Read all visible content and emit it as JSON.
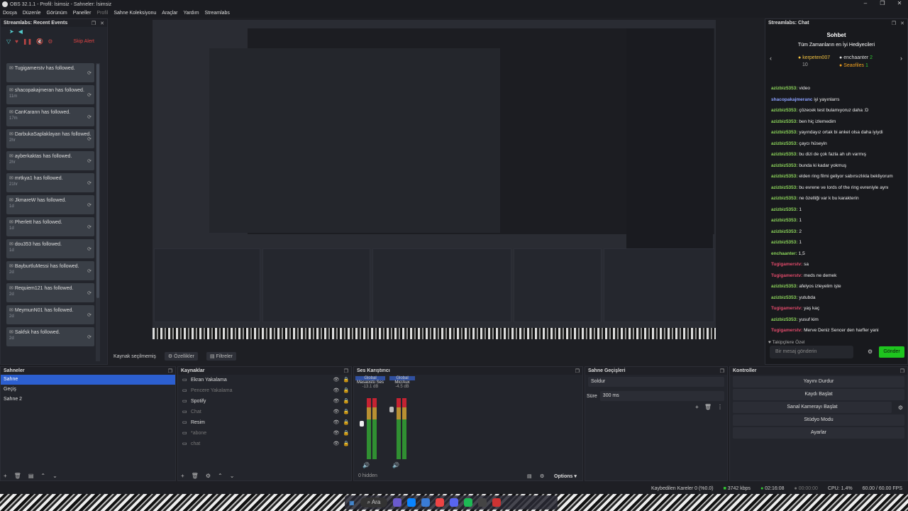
{
  "window": {
    "title": "OBS 32.1.1 - Profil: İsimsiz - Sahneler: İsimsiz"
  },
  "menu": [
    "Dosya",
    "Düzenle",
    "Görünüm",
    "Paneller",
    "Profil",
    "Sahne Koleksiyonu",
    "Araçlar",
    "Yardım",
    "Streamlabs"
  ],
  "events": {
    "title": "Streamlabs: Recent Events",
    "skip_label": "Skip Alert",
    "items": [
      {
        "name": "Tugigamerstv",
        "text": "has followed.",
        "time": ""
      },
      {
        "name": "shacopakajmeran",
        "text": "has followed.",
        "time": "11m"
      },
      {
        "name": "CanKarann",
        "text": "has followed.",
        "time": "17m"
      },
      {
        "name": "DarbukaSaplaklayan",
        "text": "has followed.",
        "time": "2hr"
      },
      {
        "name": "ayberkaktas",
        "text": "has followed.",
        "time": "2hr"
      },
      {
        "name": "mrtkya1",
        "text": "has followed.",
        "time": "21hr"
      },
      {
        "name": "JkmareW",
        "text": "has followed.",
        "time": "1d"
      },
      {
        "name": "Pherlett",
        "text": "has followed.",
        "time": "1d"
      },
      {
        "name": "dou353",
        "text": "has followed.",
        "time": "1d"
      },
      {
        "name": "BayburtluMessi",
        "text": "has followed.",
        "time": "2d"
      },
      {
        "name": "Requiem121",
        "text": "has followed.",
        "time": "2d"
      },
      {
        "name": "MeymunN01",
        "text": "has followed.",
        "time": "2d"
      },
      {
        "name": "Sakfsk",
        "text": "has followed.",
        "time": "2d"
      }
    ]
  },
  "preview": {
    "source_status": "Kaynak seçilmemiş",
    "properties_label": "Özellikler",
    "filters_label": "Filtreler"
  },
  "chat": {
    "title": "Streamlabs: Chat",
    "header": "Sohbet",
    "subheader": "Tüm Zamanların en İyi Hediyecileri",
    "leaders": [
      {
        "name": "kerpeten007",
        "score": "10"
      },
      {
        "name": "enchaanter",
        "score": "2"
      },
      {
        "name": "Seaofiles",
        "score": "1"
      }
    ],
    "messages": [
      {
        "user": "azizbiz5353:",
        "text": "video",
        "style": "u1"
      },
      {
        "user": "shacopakajmeranc",
        "text": "iyi yayınlarrs",
        "style": "u2"
      },
      {
        "user": "azizbiz5353:",
        "text": "çözecek test bulamıyoruz daha :D",
        "style": "u1"
      },
      {
        "user": "azizbiz5353:",
        "text": "ben hiç izlemedim",
        "style": "u1"
      },
      {
        "user": "azizbiz5353:",
        "text": "yayındayız ortak bi anket olsa daha iyiydi",
        "style": "u1"
      },
      {
        "user": "azizbiz5353:",
        "text": "çaycı hüseyin",
        "style": "u1"
      },
      {
        "user": "azizbiz5353:",
        "text": "bu dizi de çok fazla ah uh varmış",
        "style": "u1"
      },
      {
        "user": "azizbiz5353:",
        "text": "bunda ki kadar yokmuş",
        "style": "u1"
      },
      {
        "user": "azizbiz5353:",
        "text": "elden ring filmi geliyor sabırsızlıkla bekliyorum",
        "style": "u1"
      },
      {
        "user": "azizbiz5353:",
        "text": "bu evrene ve lords of the ring evreniyle aynı",
        "style": "u1"
      },
      {
        "user": "azizbiz5353:",
        "text": "ne özelliği var k bu karakterin",
        "style": "u1"
      },
      {
        "user": "azizbiz5353:",
        "text": "1",
        "style": "u1"
      },
      {
        "user": "azizbiz5353:",
        "text": "1",
        "style": "u1"
      },
      {
        "user": "azizbiz5353:",
        "text": "2",
        "style": "u1"
      },
      {
        "user": "azizbiz5353:",
        "text": "1",
        "style": "u1"
      },
      {
        "user": "enchaanter:",
        "text": "1,5",
        "style": "u4"
      },
      {
        "user": "Tugigamerstv:",
        "text": "sa",
        "style": "u3"
      },
      {
        "user": "Tugigamerstv:",
        "text": "meds ne demek",
        "style": "u3"
      },
      {
        "user": "azizbiz5353:",
        "text": "afelyos izleyelim işte",
        "style": "u1"
      },
      {
        "user": "azizbiz5353:",
        "text": "yutubda",
        "style": "u1"
      },
      {
        "user": "Tugigamerstv:",
        "text": "yaş kaç",
        "style": "u3"
      },
      {
        "user": "azizbiz5353:",
        "text": "yusuf kim",
        "style": "u1"
      },
      {
        "user": "Tugigamerstv:",
        "text": "Merve Deniz Sencer den harfler yani",
        "style": "u3"
      }
    ],
    "followers_only": "Takipçilere Özel",
    "input_placeholder": "Bir mesaj gönderin",
    "send_label": "Gönder"
  },
  "scenes": {
    "title": "Sahneler",
    "items": [
      "Sahne",
      "Geçiş",
      "Sahne 2"
    ],
    "selected": 0
  },
  "sources": {
    "title": "Kaynaklar",
    "items": [
      {
        "name": "Ekran Yakalama",
        "dim": false
      },
      {
        "name": "Pencere Yakalama",
        "dim": true
      },
      {
        "name": "Spotify",
        "dim": false
      },
      {
        "name": "Chat",
        "dim": true
      },
      {
        "name": "Resim",
        "dim": false
      },
      {
        "name": "*abone",
        "dim": true
      },
      {
        "name": "chat",
        "dim": true
      }
    ]
  },
  "mixer": {
    "title": "Ses Karıştırıcı",
    "ch1": {
      "label": "Masaüstü Ses",
      "tag": "Global",
      "db": "-13.1 dB"
    },
    "ch2": {
      "label": "Mic/Aux",
      "tag": "Global",
      "db": "-4.5 dB"
    },
    "hidden": "0 hidden",
    "options": "Options"
  },
  "transitions": {
    "title": "Sahne Geçişleri",
    "type": "Soldur",
    "duration_label": "Süre",
    "duration": "300 ms"
  },
  "controls": {
    "title": "Kontroller",
    "buttons": [
      "Yayını Durdur",
      "Kaydı Başlat",
      "Sanal Kamerayı Başlat",
      "Stüdyo Modu",
      "Ayarlar"
    ]
  },
  "status": {
    "dropped": "Kaybedilen Kareler 0 (%0.0)",
    "kbps": "3742 kbps",
    "live_time": "02:16:08",
    "rec_time": "00:00:00",
    "cpu": "CPU: 1.4%",
    "fps": "60.00 / 60.00 FPS"
  },
  "taskbar": {
    "search": "Ara"
  },
  "colors": {
    "accent": "#2c5fd0",
    "send": "#1ec51e",
    "skip": "#e04444"
  }
}
